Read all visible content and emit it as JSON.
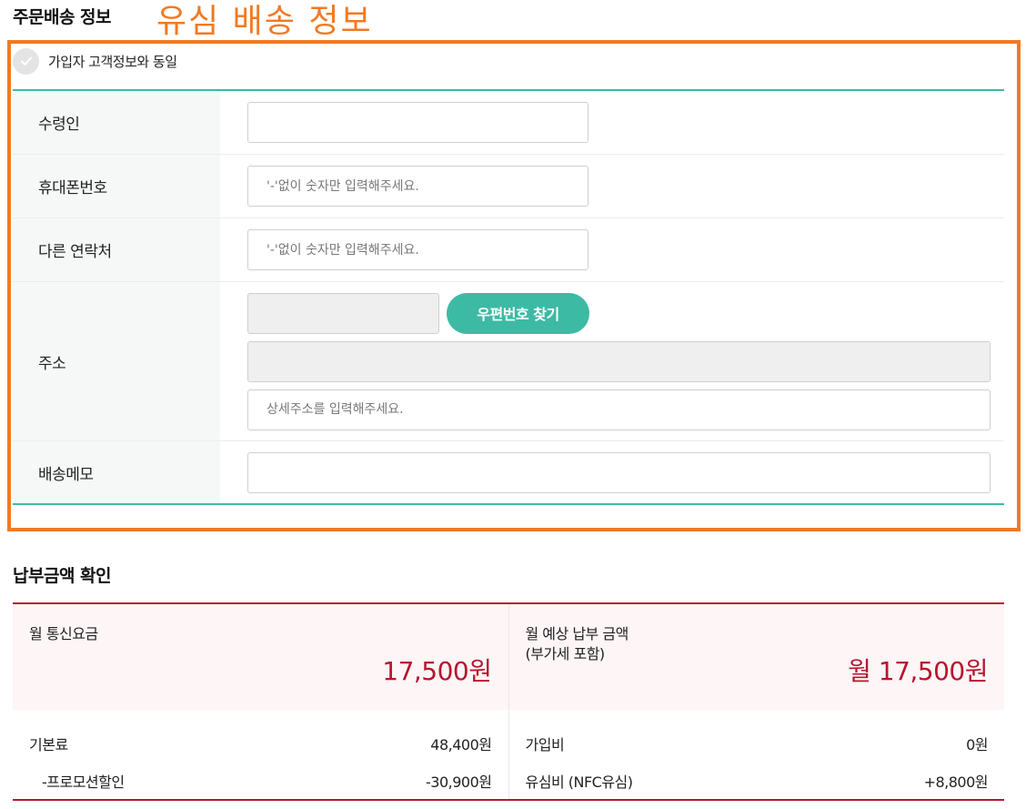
{
  "header": {
    "title": "주문배송 정보",
    "annotation": "유심 배송 정보"
  },
  "same_as_customer": {
    "label": "가입자 고객정보와 동일",
    "checked": false
  },
  "form": {
    "recipient": {
      "label": "수령인",
      "value": ""
    },
    "mobile": {
      "label": "휴대폰번호",
      "placeholder": "'-'없이 숫자만 입력해주세요."
    },
    "other_contact": {
      "label": "다른 연락처",
      "placeholder": "'-'없이 숫자만 입력해주세요."
    },
    "address": {
      "label": "주소",
      "zip_button": "우편번호 찾기",
      "detail_placeholder": "상세주소를 입력해주세요."
    },
    "memo": {
      "label": "배송메모",
      "value": ""
    }
  },
  "payment": {
    "title": "납부금액 확인",
    "monthly_fee": {
      "label": "월 통신요금",
      "amount": "17,500원",
      "base_label": "기본료",
      "base_value": "48,400원",
      "promo_label": "-프로모션할인",
      "promo_value": "-30,900원"
    },
    "expected": {
      "label": "월 예상 납부 금액",
      "label_sub": "(부가세 포함)",
      "amount": "월 17,500원",
      "join_fee_label": "가입비",
      "join_fee_value": "0원",
      "usim_label": "유심비 (NFC유심)",
      "usim_value": "+8,800원"
    }
  },
  "colors": {
    "accent_teal": "#3dbaa4",
    "annotation_orange": "#f07a24",
    "price_red": "#b5172f"
  }
}
